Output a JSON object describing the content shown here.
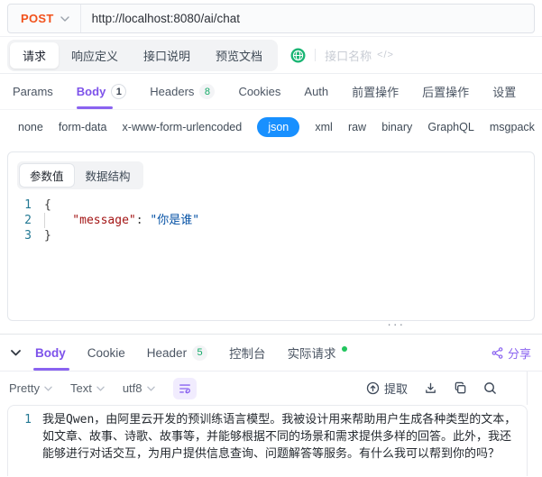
{
  "colors": {
    "accent_purple": "#7d52ea",
    "method_post": "#f1511b",
    "json_pill_blue": "#1890ff",
    "globe_green": "#19b573",
    "live_dot_green": "#22c55e",
    "code_key": "#a31515",
    "code_value": "#0451a5",
    "line_number": "#237893"
  },
  "request_bar": {
    "method": "POST",
    "url": "http://localhost:8080/ai/chat"
  },
  "doc_tabs": {
    "items": [
      {
        "label": "请求"
      },
      {
        "label": "响应定义"
      },
      {
        "label": "接口说明"
      },
      {
        "label": "预览文档"
      }
    ],
    "active": "请求",
    "api_name_placeholder": "接口名称",
    "code_glyph": "</>"
  },
  "request_tabs": {
    "items": [
      {
        "label": "Params"
      },
      {
        "label": "Body",
        "badge": "1"
      },
      {
        "label": "Headers",
        "badge": "8"
      },
      {
        "label": "Cookies"
      },
      {
        "label": "Auth"
      },
      {
        "label": "前置操作"
      },
      {
        "label": "后置操作"
      },
      {
        "label": "设置"
      }
    ],
    "active": "Body"
  },
  "body_types": {
    "items": [
      {
        "label": "none"
      },
      {
        "label": "form-data"
      },
      {
        "label": "x-www-form-urlencoded"
      },
      {
        "label": "json"
      },
      {
        "label": "xml"
      },
      {
        "label": "raw"
      },
      {
        "label": "binary"
      },
      {
        "label": "GraphQL"
      },
      {
        "label": "msgpack"
      }
    ],
    "active": "json"
  },
  "editor": {
    "mode_tabs": [
      {
        "label": "参数值"
      },
      {
        "label": "数据结构"
      }
    ],
    "active_mode": "参数值",
    "line_numbers": [
      "1",
      "2",
      "3"
    ],
    "code": {
      "line1": "{",
      "line2_key": "\"message\"",
      "line2_sep": ": ",
      "line2_value": "\"你是谁\"",
      "line3": "}"
    }
  },
  "splitter": {
    "handle": "···"
  },
  "response_panel": {
    "tabs": [
      {
        "label": "Body"
      },
      {
        "label": "Cookie"
      },
      {
        "label": "Header",
        "badge": "5"
      },
      {
        "label": "控制台"
      },
      {
        "label": "实际请求",
        "live": true
      }
    ],
    "active": "Body",
    "share_label": "分享"
  },
  "response_toolbar": {
    "format": "Pretty",
    "view_type": "Text",
    "encoding": "utf8",
    "extract_label": "提取"
  },
  "response_body": {
    "line_number": "1",
    "text": "我是Qwen，由阿里云开发的预训练语言模型。我被设计用来帮助用户生成各种类型的文本，如文章、故事、诗歌、故事等，并能够根据不同的场景和需求提供多样的回答。此外，我还能够进行对话交互，为用户提供信息查询、问题解答等服务。有什么我可以帮到你的吗？"
  }
}
